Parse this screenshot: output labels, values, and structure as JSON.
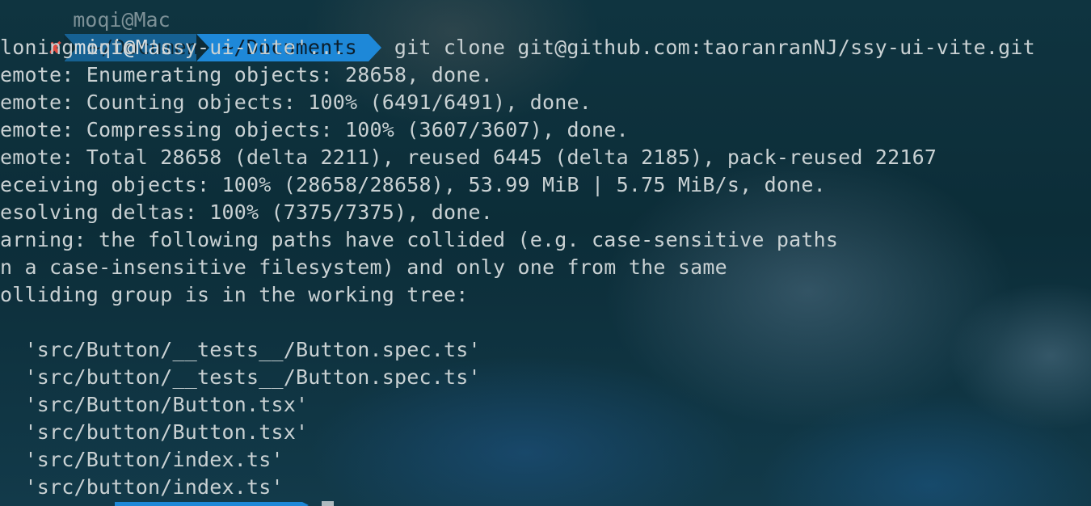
{
  "colors": {
    "background": "#0c2d38",
    "text": "#c9d1d3",
    "path_segment": "#1e88d8",
    "error_mark": "#e04a3f"
  },
  "prompt": {
    "status_icon": "x-mark-icon",
    "status_glyph": "✘",
    "user_host": "moqi@Mac",
    "directory": "~/Documents",
    "command": "git clone git@github.com:taoranranNJ/ssy-ui-vite.git"
  },
  "previous_prompt": {
    "user_host": "moqi@Mac",
    "directory": "~/Documents"
  },
  "output_lines": [
    "loning into 'ssy-ui-vite'...",
    "emote: Enumerating objects: 28658, done.",
    "emote: Counting objects: 100% (6491/6491), done.",
    "emote: Compressing objects: 100% (3607/3607), done.",
    "emote: Total 28658 (delta 2211), reused 6445 (delta 2185), pack-reused 22167",
    "eceiving objects: 100% (28658/28658), 53.99 MiB | 5.75 MiB/s, done.",
    "esolving deltas: 100% (7375/7375), done.",
    "arning: the following paths have collided (e.g. case-sensitive paths",
    "n a case-insensitive filesystem) and only one from the same",
    "olliding group is in the working tree:",
    "",
    "  'src/Button/__tests__/Button.spec.ts'",
    "  'src/button/__tests__/Button.spec.ts'",
    "  'src/Button/Button.tsx'",
    "  'src/button/Button.tsx'",
    "  'src/Button/index.ts'",
    "  'src/button/index.ts'"
  ]
}
